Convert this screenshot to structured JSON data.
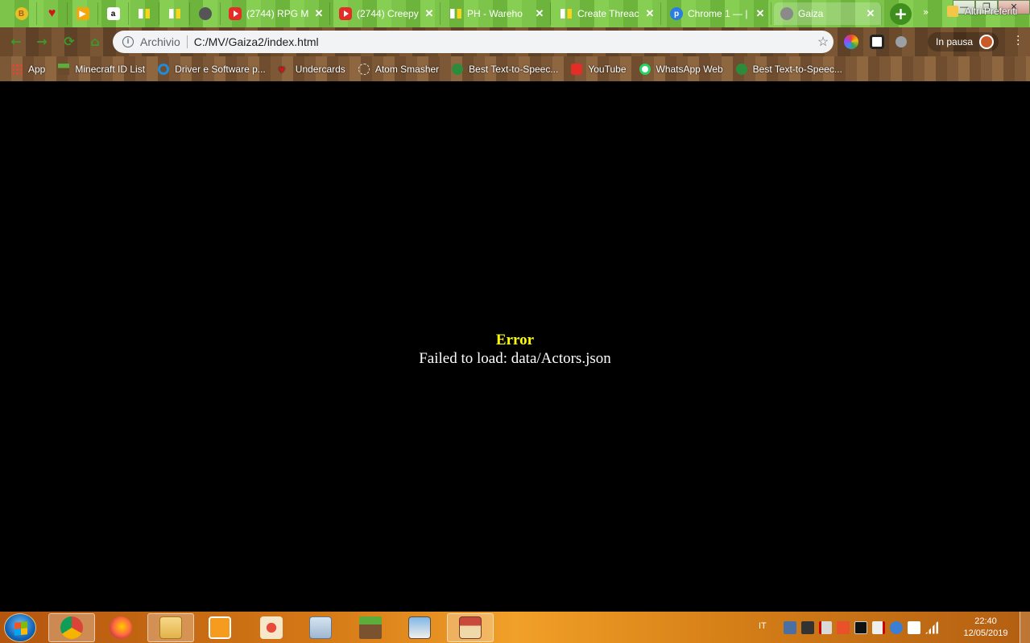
{
  "browser": {
    "tabs": [
      {
        "title": "",
        "icon": "pb-icon",
        "pinned": true
      },
      {
        "title": "",
        "icon": "heart-icon",
        "pinned": true
      },
      {
        "title": "",
        "icon": "play-icon",
        "pinned": true
      },
      {
        "title": "",
        "icon": "amazon-icon",
        "pinned": true
      },
      {
        "title": "",
        "icon": "bars-icon",
        "pinned": true
      },
      {
        "title": "",
        "icon": "bars-icon",
        "pinned": true
      },
      {
        "title": "",
        "icon": "cat-icon",
        "pinned": true
      },
      {
        "title": "(2744) RPG M",
        "icon": "youtube-icon",
        "close": "✕"
      },
      {
        "title": "(2744) Creepy",
        "icon": "youtube-icon",
        "close": "✕"
      },
      {
        "title": "PH - Wareho",
        "icon": "bars-icon",
        "close": "✕"
      },
      {
        "title": "Create Threac",
        "icon": "bars-icon",
        "close": "✕"
      },
      {
        "title": "Chrome 1 — |",
        "icon": "p-icon",
        "close": "✕"
      },
      {
        "title": "Gaiza",
        "icon": "bot-icon",
        "close": "✕",
        "active": true
      }
    ],
    "new_tab": "+",
    "window_controls": {
      "minimize": "—",
      "restore": "❐",
      "close": "✕"
    },
    "nav": {
      "back": "←",
      "forward": "→",
      "reload": "⟳",
      "home": "⌂"
    },
    "omnibox": {
      "security_label": "Archivio",
      "url": "C:/MV/Gaiza2/index.html",
      "star": "☆"
    },
    "profile": {
      "status": "In pausa"
    },
    "bookmarks": [
      {
        "label": "App",
        "icon": "apps-grid-icon"
      },
      {
        "label": "Minecraft ID List",
        "icon": "minecraft-icon"
      },
      {
        "label": "Driver e Software p...",
        "icon": "hp-icon"
      },
      {
        "label": "Undercards",
        "icon": "heart-icon"
      },
      {
        "label": "Atom Smasher",
        "icon": "atom-icon"
      },
      {
        "label": "Best Text-to-Speec...",
        "icon": "globe-icon"
      },
      {
        "label": "YouTube",
        "icon": "youtube-icon"
      },
      {
        "label": "WhatsApp Web",
        "icon": "whatsapp-icon"
      },
      {
        "label": "Best Text-to-Speec...",
        "icon": "globe-icon"
      }
    ],
    "bookmarks_more": "»",
    "other_bookmarks": "Altri Preferiti"
  },
  "page": {
    "error_title": "Error",
    "error_message": "Failed to load: data/Actors.json"
  },
  "taskbar": {
    "apps": [
      {
        "name": "chrome",
        "open": true
      },
      {
        "name": "firefox",
        "open": false
      },
      {
        "name": "explorer",
        "open": true
      },
      {
        "name": "media-player",
        "open": false
      },
      {
        "name": "snipping-tool",
        "open": false
      },
      {
        "name": "calculator",
        "open": false
      },
      {
        "name": "minecraft",
        "open": false
      },
      {
        "name": "rpg-maker",
        "open": false
      },
      {
        "name": "rpg-game",
        "open": true
      }
    ],
    "language": "IT",
    "time": "22:40",
    "date": "12/05/2019"
  },
  "colors": {
    "error_title": "#ffff00",
    "error_message": "#ffffff",
    "background": "#000000"
  }
}
